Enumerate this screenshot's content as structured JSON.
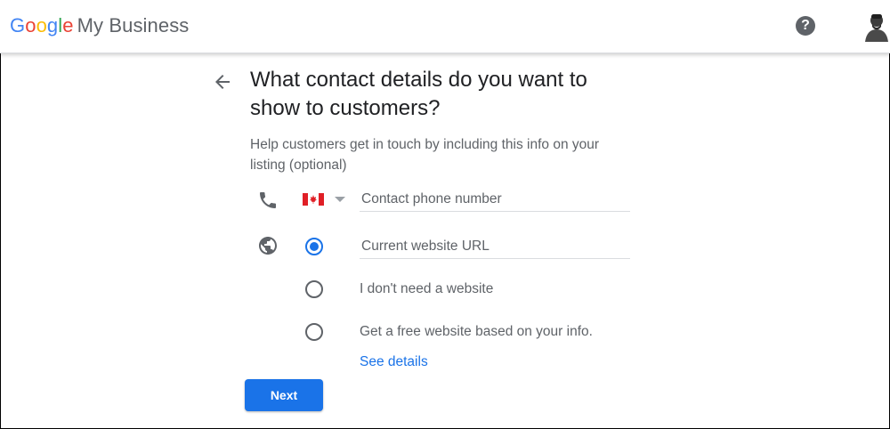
{
  "header": {
    "brand_letters": [
      "G",
      "o",
      "o",
      "g",
      "l",
      "e"
    ],
    "product_name": "My Business",
    "help_glyph": "?",
    "icons": {
      "help": "help-circle-icon",
      "avatar": "user-avatar"
    }
  },
  "page": {
    "title": "What contact details do you want to show to customers?",
    "subtitle": "Help customers get in touch by including this info on your listing (optional)"
  },
  "phone": {
    "icon": "phone-icon",
    "country_flag": "canada-flag",
    "placeholder": "Contact phone number",
    "value": ""
  },
  "website": {
    "icon": "globe-icon",
    "placeholder": "Current website URL",
    "value": "",
    "options": [
      {
        "label": "",
        "selected": true
      },
      {
        "label": "I don't need a website",
        "selected": false
      },
      {
        "label": "Get a free website based on your info.",
        "selected": false
      }
    ],
    "details_link": "See details"
  },
  "actions": {
    "next_label": "Next"
  },
  "colors": {
    "primary": "#1a73e8",
    "text": "#202124",
    "secondary_text": "#5f6368",
    "divider": "#dadce0"
  }
}
